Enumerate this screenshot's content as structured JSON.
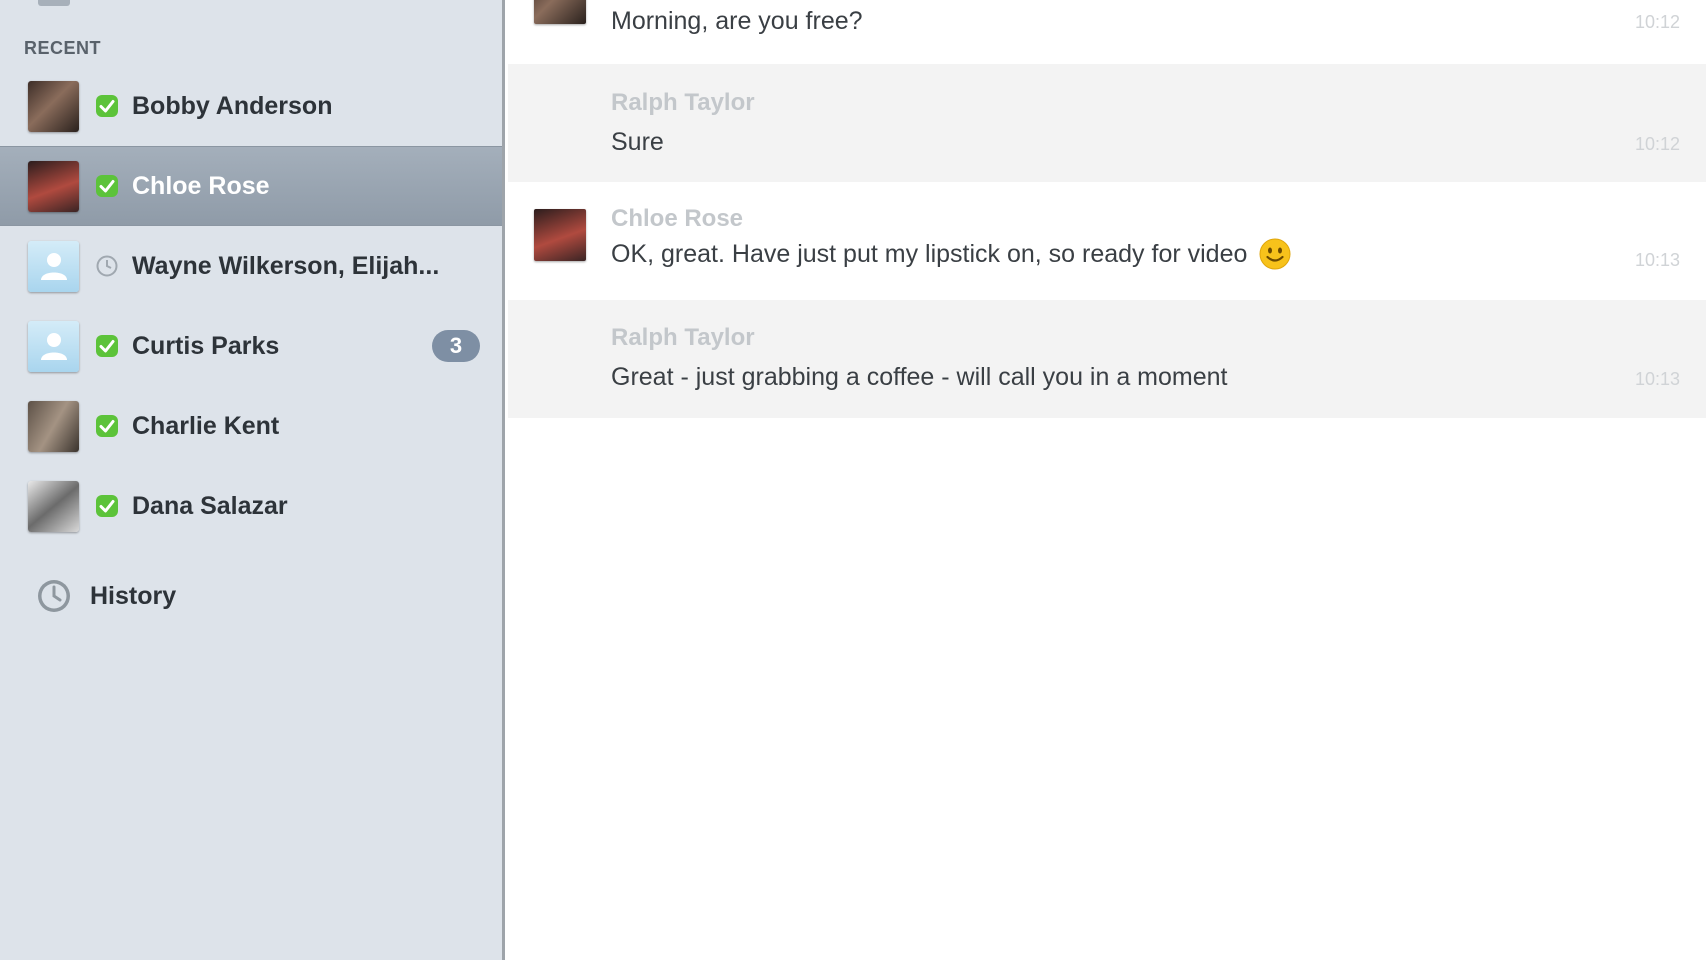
{
  "sidebar": {
    "section_label": "RECENT",
    "contacts": [
      {
        "name": "Bobby Anderson",
        "status": "online"
      },
      {
        "name": "Chloe Rose",
        "status": "online",
        "selected": true
      },
      {
        "name": "Wayne Wilkerson, Elijah...",
        "status": "group"
      },
      {
        "name": "Curtis Parks",
        "status": "online",
        "unread": "3"
      },
      {
        "name": "Charlie Kent",
        "status": "online"
      },
      {
        "name": "Dana Salazar",
        "status": "online"
      }
    ],
    "history_label": "History"
  },
  "chat": {
    "messages": [
      {
        "sender": "",
        "text": "Morning, are you free?",
        "time": "10:12"
      },
      {
        "sender": "Ralph Taylor",
        "text": "Sure",
        "time": "10:12"
      },
      {
        "sender": "Chloe Rose",
        "text": "OK, great. Have just put my lipstick on, so ready for video",
        "time": "10:13",
        "emoji": "smiley-icon"
      },
      {
        "sender": "Ralph Taylor",
        "text": "Great - just  grabbing a coffee - will call you in a moment",
        "time": "10:13"
      }
    ]
  },
  "colors": {
    "sidebar_bg": "#dde3ea",
    "selected_row": "#98a4b1",
    "online_green": "#5cc33a",
    "badge": "#7e8fa4"
  }
}
